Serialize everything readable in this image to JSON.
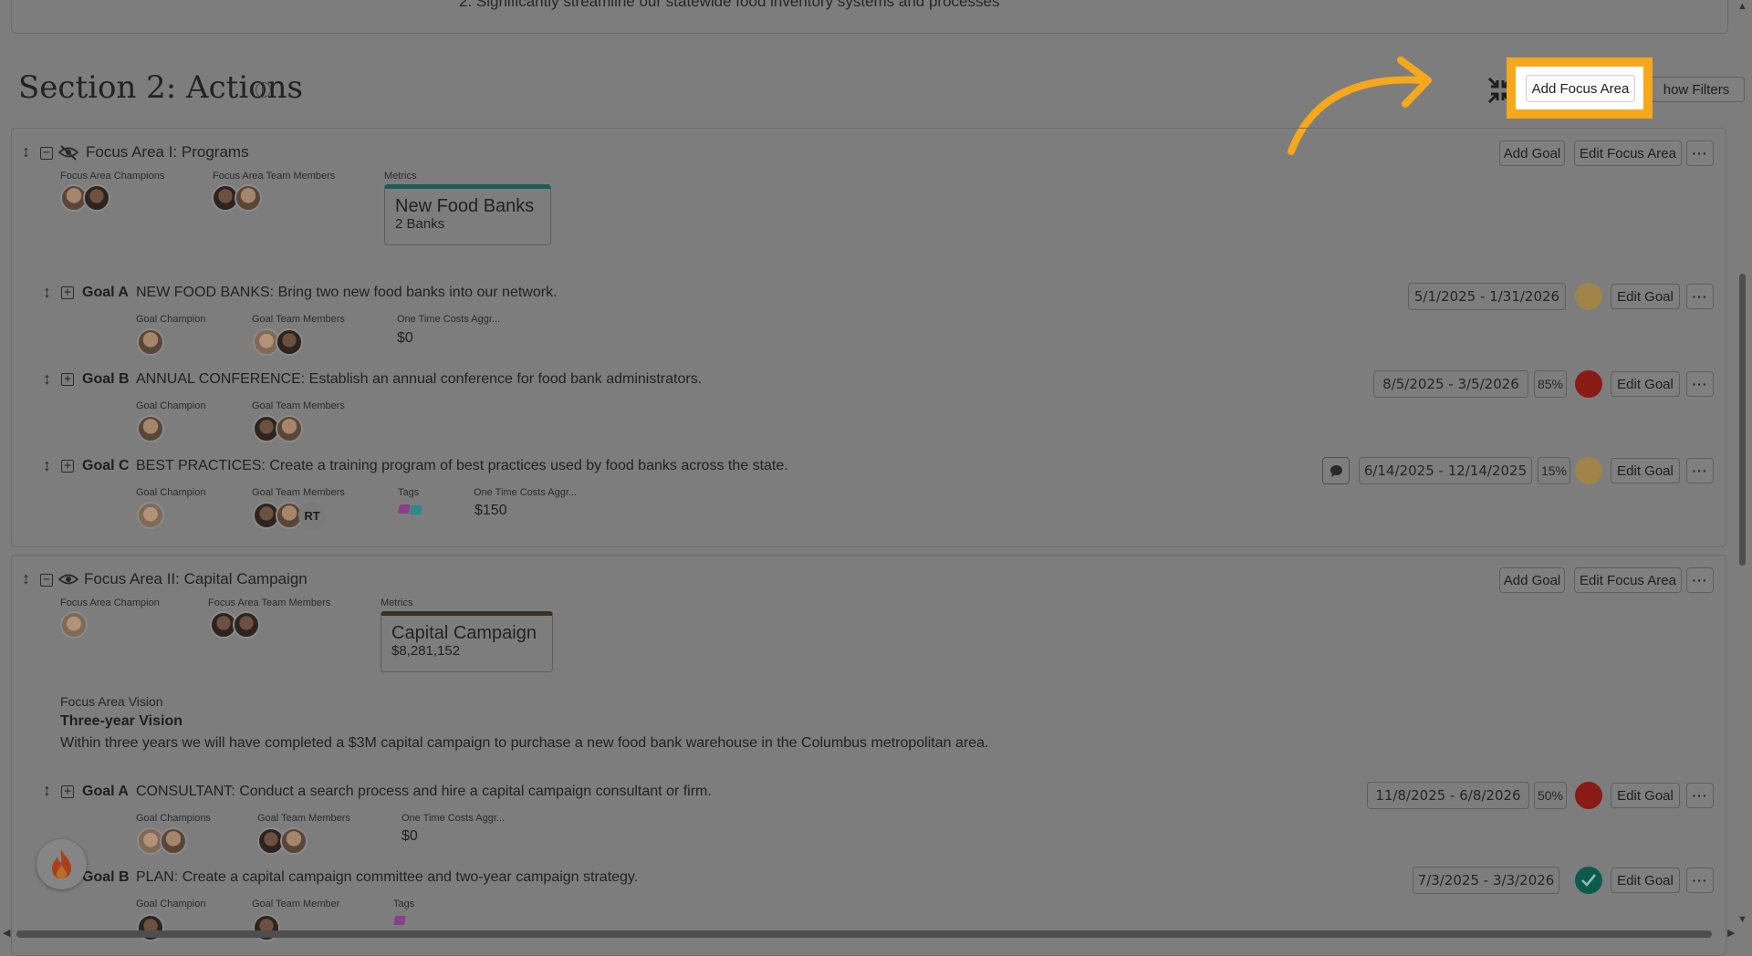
{
  "top_card": {
    "text": "2. Significantly streamline our statewide food inventory systems and processes"
  },
  "section": {
    "title": "Section 2: Actions",
    "info_icon": "i",
    "add_focus_area": "Add Focus Area",
    "show_filters": "how Filters"
  },
  "focus_areas": [
    {
      "title": "Focus Area I: Programs",
      "champions_label": "Focus Area Champions",
      "team_label": "Focus Area Team Members",
      "metrics_label": "Metrics",
      "metric_title": "New Food Banks",
      "metric_value": "2 Banks",
      "add_goal": "Add Goal",
      "edit_focus_area": "Edit Focus Area",
      "more": "···",
      "goals": [
        {
          "prefix": "Goal A",
          "text": "NEW FOOD BANKS: Bring two new food banks into our network.",
          "champion_label": "Goal Champion",
          "team_label": "Goal Team Members",
          "costs_label": "One Time Costs Aggr...",
          "costs_value": "$0",
          "dates": "5/1/2025 - 1/31/2026",
          "status_color": "#a08449",
          "edit": "Edit Goal",
          "more": "···"
        },
        {
          "prefix": "Goal B",
          "text": "ANNUAL CONFERENCE: Establish an annual conference for food bank administrators.",
          "champion_label": "Goal Champion",
          "team_label": "Goal Team Members",
          "dates": "8/5/2025 - 3/5/2026",
          "percent": "85%",
          "status_color": "#8a1a14",
          "edit": "Edit Goal",
          "more": "···"
        },
        {
          "prefix": "Goal C",
          "text": "BEST PRACTICES: Create a training program of best practices used by food banks across the state.",
          "champion_label": "Goal Champion",
          "team_label": "Goal Team Members",
          "team_initials": "RT",
          "tags_label": "Tags",
          "costs_label": "One Time Costs Aggr...",
          "costs_value": "$150",
          "dates": "6/14/2025 - 12/14/2025",
          "percent": "15%",
          "status_color": "#a08449",
          "edit": "Edit Goal",
          "more": "···"
        }
      ]
    },
    {
      "title": "Focus Area II: Capital Campaign",
      "champions_label": "Focus Area Champion",
      "team_label": "Focus Area Team Members",
      "metrics_label": "Metrics",
      "metric_title": "Capital Campaign",
      "metric_value": "$8,281,152",
      "vision_label": "Focus Area Vision",
      "vision_heading": "Three-year Vision",
      "vision_text": "Within three years we will have completed a $3M capital campaign to purchase a new food bank warehouse in the Columbus metropolitan area.",
      "add_goal": "Add Goal",
      "edit_focus_area": "Edit Focus Area",
      "more": "···",
      "goals": [
        {
          "prefix": "Goal A",
          "text": "CONSULTANT: Conduct a search process and hire a capital campaign consultant or firm.",
          "champion_label": "Goal Champions",
          "team_label": "Goal Team Members",
          "costs_label": "One Time Costs Aggr...",
          "costs_value": "$0",
          "dates": "11/8/2025 - 6/8/2026",
          "percent": "50%",
          "status_color": "#8a1a14",
          "edit": "Edit Goal",
          "more": "···"
        },
        {
          "prefix": "Goal B",
          "text": "PLAN: Create a capital campaign committee and two-year campaign strategy.",
          "champion_label": "Goal Champion",
          "team_label": "Goal Team Member",
          "tags_label": "Tags",
          "dates": "7/3/2025 - 3/3/2026",
          "status": "complete",
          "status_color": "#0c5a4e",
          "edit": "Edit Goal",
          "more": "···"
        }
      ]
    }
  ],
  "colors": {
    "overlay": "#7d7d7d",
    "highlight": "#f5a81c",
    "metric_bar_1": "#1d5c58",
    "metric_bar_2": "#3a3127",
    "tag_purple": "#8a3f8a",
    "tag_teal": "#2a8a8a"
  },
  "icons": [
    "drag-handle-icon",
    "collapse-icon",
    "expand-icon",
    "visibility-off-icon",
    "visibility-icon",
    "collapse-all-icon",
    "comment-icon",
    "check-icon",
    "fire-icon",
    "tutorial-arrow-icon"
  ]
}
